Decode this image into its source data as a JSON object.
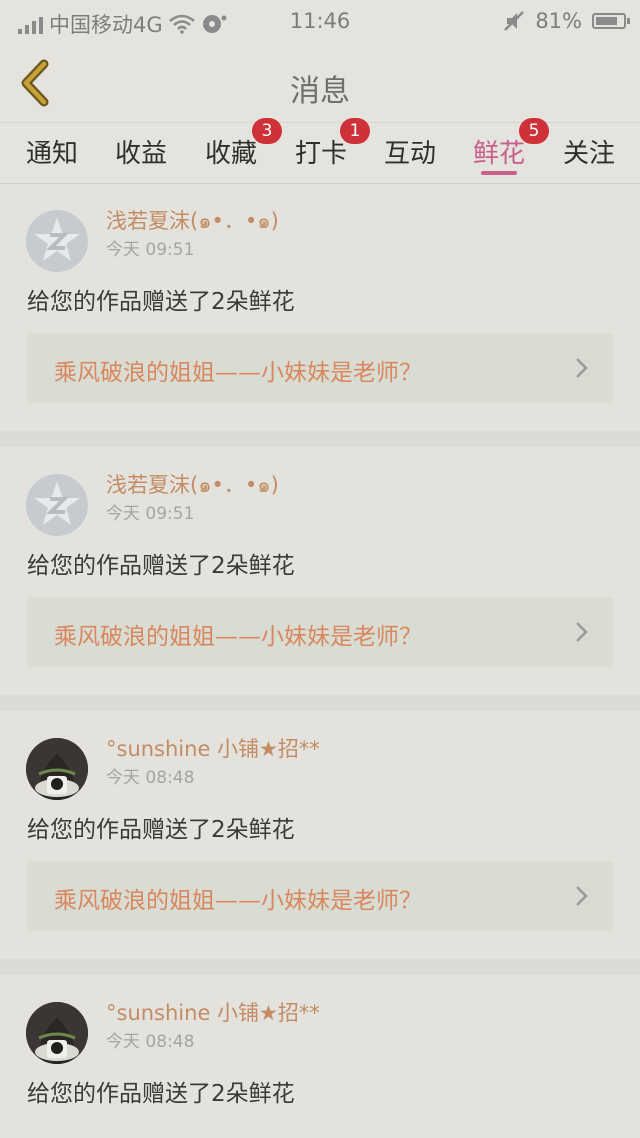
{
  "status_bar": {
    "carrier": "中国移动4G",
    "time": "11:46",
    "battery": "81%",
    "battery_level": 0.81,
    "icons": [
      "signal-icon",
      "wifi-icon",
      "sync-icon",
      "mute-icon",
      "battery-icon"
    ]
  },
  "header": {
    "title": "消息",
    "back_icon": "chevron-left-icon"
  },
  "tabs": [
    {
      "label": "通知",
      "badge": ""
    },
    {
      "label": "收益",
      "badge": ""
    },
    {
      "label": "收藏",
      "badge": "3"
    },
    {
      "label": "打卡",
      "badge": "1"
    },
    {
      "label": "互动",
      "badge": ""
    },
    {
      "label": "鲜花",
      "badge": "5",
      "active": true
    },
    {
      "label": "关注",
      "badge": ""
    }
  ],
  "colors": {
    "accent": "#c9608c",
    "badge": "#cf3138",
    "username": "#c38c64",
    "work_link": "#d9875e"
  },
  "messages": [
    {
      "user": "浅若夏沫(๑•．•๑)",
      "time": "今天 09:51",
      "text": "给您的作品赠送了2朵鲜花",
      "work": "乘风破浪的姐姐——小妹妹是老师？"
    },
    {
      "user": "浅若夏沫(๑•．•๑)",
      "time": "今天 09:51",
      "text": "给您的作品赠送了2朵鲜花",
      "work": "乘风破浪的姐姐——小妹妹是老师？"
    },
    {
      "user": "°sunshine 小铺★招**",
      "time": "今天 08:48",
      "text": "给您的作品赠送了2朵鲜花",
      "work": "乘风破浪的姐姐——小妹妹是老师？"
    },
    {
      "user": "°sunshine 小铺★招**",
      "time": "今天 08:48",
      "text": "给您的作品赠送了2朵鲜花",
      "work": ""
    }
  ]
}
